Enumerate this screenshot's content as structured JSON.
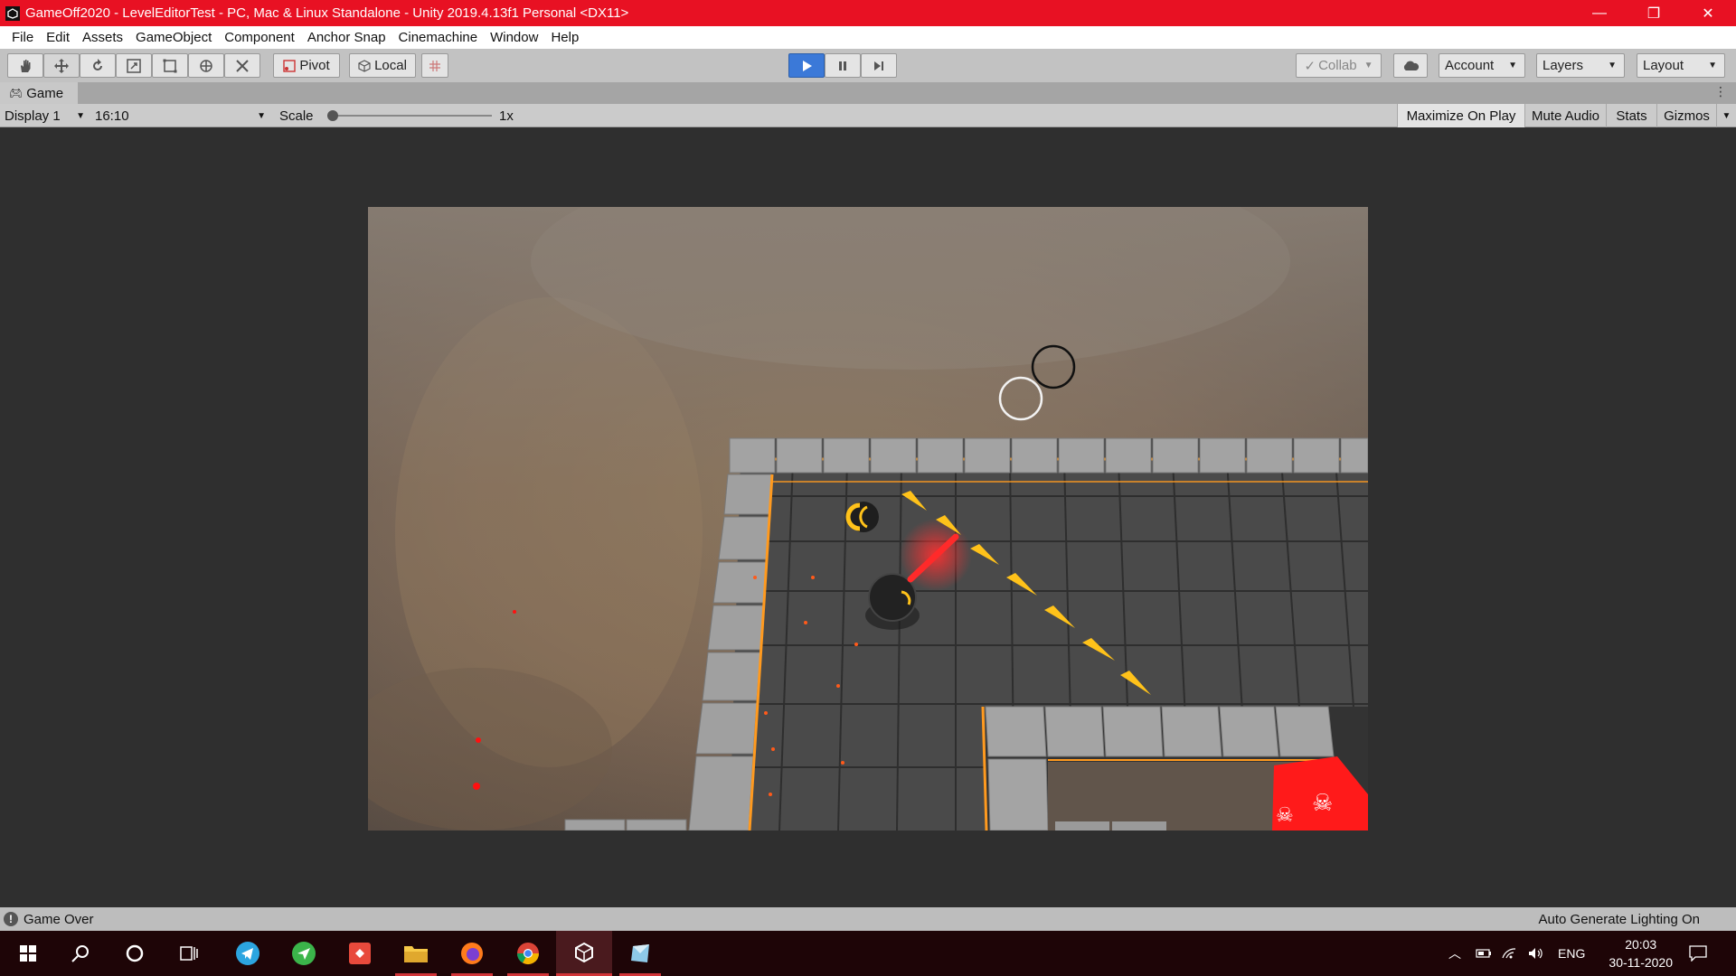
{
  "window": {
    "title": "GameOff2020 - LevelEditorTest - PC, Mac & Linux Standalone - Unity 2019.4.13f1 Personal <DX11>",
    "minimize": "—",
    "restore": "❐",
    "close": "✕"
  },
  "menu": [
    "File",
    "Edit",
    "Assets",
    "GameObject",
    "Component",
    "Anchor Snap",
    "Cinemachine",
    "Window",
    "Help"
  ],
  "toolbar": {
    "pivot_label": "Pivot",
    "local_label": "Local",
    "collab_label": "Collab",
    "account_label": "Account",
    "layers_label": "Layers",
    "layout_label": "Layout",
    "play_state": "playing"
  },
  "game_tab": {
    "label": "Game"
  },
  "game_bar": {
    "display": "Display 1",
    "aspect": "16:10",
    "scale_label": "Scale",
    "scale_value": "1x",
    "scale_slider": 0.0,
    "maximize_on_play": "Maximize On Play",
    "mute_audio": "Mute Audio",
    "stats": "Stats",
    "gizmos": "Gizmos"
  },
  "status": {
    "message": "Game Over",
    "lighting": "Auto Generate Lighting On"
  },
  "taskbar": {
    "apps": [
      "start-icon",
      "search-icon",
      "cortana-icon",
      "task-view-icon",
      "telegram-icon",
      "messenger-icon",
      "git-icon",
      "file-explorer-icon",
      "firefox-icon",
      "chrome-icon",
      "unity-icon",
      "app-icon"
    ],
    "language": "ENG",
    "time": "20:03",
    "date": "30-11-2020"
  },
  "colors": {
    "titlebar": "#e81123",
    "play_active": "#3b79d8",
    "laser": "#ff2a2a",
    "arrow": "#ffc21a",
    "death_tile": "#ff1a1a"
  }
}
